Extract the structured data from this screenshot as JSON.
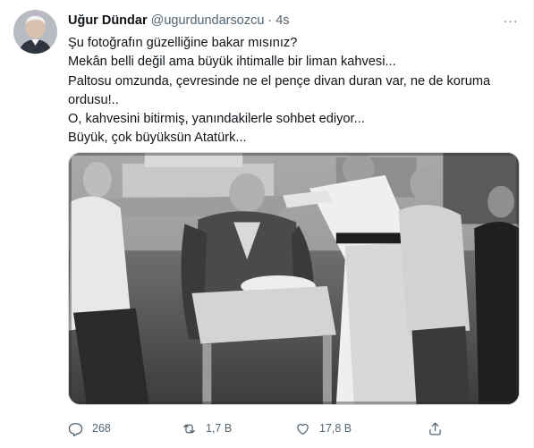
{
  "tweet": {
    "display_name": "Uğur Dündar",
    "handle": "@ugurdundarsozcu",
    "separator": "·",
    "time": "4s",
    "more_label": "···",
    "text_lines": [
      "Şu fotoğrafın güzelliğine bakar mısınız?",
      "Mekân belli değil ama büyük ihtimalle bir liman kahvesi...",
      "Paltosu omzunda, çevresinde ne el pençe divan duran var, ne de koruma",
      "ordusu!..",
      "O, kahvesini bitirmiş, yanındakilerle sohbet ediyor...",
      "Büyük, çok büyüksün Atatürk..."
    ]
  },
  "actions": {
    "reply_count": "268",
    "retweet_count": "1,7 B",
    "like_count": "17,8 B"
  },
  "icons": {
    "reply": "reply-icon",
    "retweet": "retweet-icon",
    "like": "heart-icon",
    "share": "share-icon",
    "more": "more-dots-icon"
  },
  "colors": {
    "text_primary": "#0f1419",
    "text_secondary": "#536471",
    "border": "#cfd9de"
  }
}
